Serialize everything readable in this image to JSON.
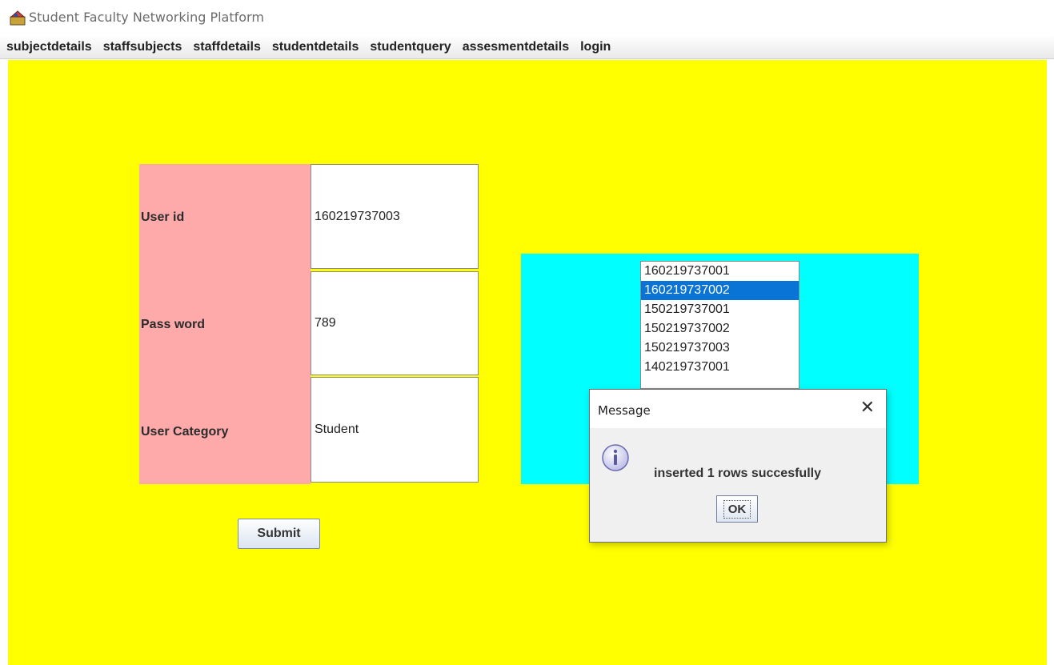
{
  "window": {
    "title": "Student Faculty Networking Platform"
  },
  "menu": {
    "items": [
      {
        "label": "subjectdetails"
      },
      {
        "label": "staffsubjects"
      },
      {
        "label": "staffdetails"
      },
      {
        "label": "studentdetails"
      },
      {
        "label": "studentquery"
      },
      {
        "label": "assesmentdetails"
      },
      {
        "label": "login"
      }
    ]
  },
  "form": {
    "user_id": {
      "label": "User id",
      "value": "160219737003"
    },
    "password": {
      "label": "Pass word",
      "value": "789"
    },
    "category": {
      "label": "User Category",
      "value": "Student"
    },
    "submit_label": "Submit"
  },
  "list": {
    "items": [
      "160219737001",
      "160219737002",
      "150219737001",
      "150219737002",
      "150219737003",
      "140219737001"
    ],
    "selected_index": 1
  },
  "dialog": {
    "title": "Message",
    "close_symbol": "✕",
    "message": "inserted 1 rows succesfully",
    "ok_label": "OK",
    "icon": "info-icon"
  },
  "colors": {
    "main_bg": "#ffff00",
    "label_bg": "#ffaaaa",
    "list_panel_bg": "#00ffff",
    "selection": "#0a73d6"
  }
}
